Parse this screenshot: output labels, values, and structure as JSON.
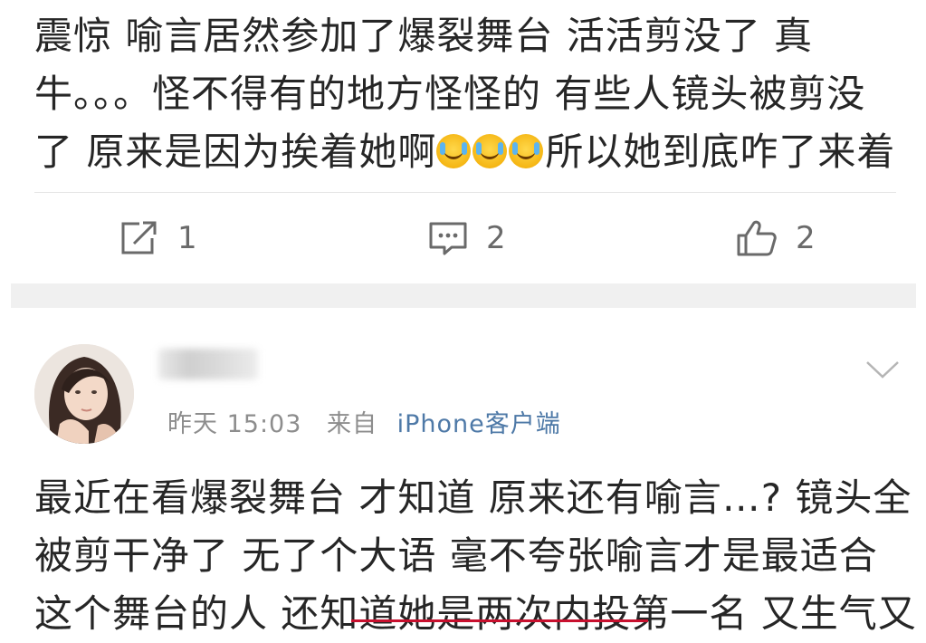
{
  "post_top": {
    "lines": [
      "震惊 喻言居然参加了爆裂舞台  活活剪没了 真",
      "牛。。。怪不得有的地方怪怪的 有些人镜头被剪没",
      "了 原来是因为挨着她啊",
      "所以她到底咋了来着"
    ],
    "emoji_name": "crying-laughing-emoji",
    "actions": {
      "forward_count": "1",
      "comment_count": "2",
      "like_count": "2"
    }
  },
  "post_second": {
    "time": "昨天 15:03",
    "source_prefix": "来自",
    "source": "iPhone客户端",
    "lines": [
      "最近在看爆裂舞台 才知道 原来还有喻言…? 镜头全",
      "被剪干净了  无了个大语 毫不夸张喻言才是最适合",
      "这个舞台的人 还知道她是两次内投第一名 又生气又"
    ]
  },
  "colors": {
    "text": "#262626",
    "meta": "#8d8d8d",
    "source_link": "#4e79a7",
    "underline": "#c8102e",
    "separator": "#f0f0f0"
  },
  "icons": [
    "forward-icon",
    "comment-icon",
    "like-icon",
    "chevron-down-icon"
  ]
}
